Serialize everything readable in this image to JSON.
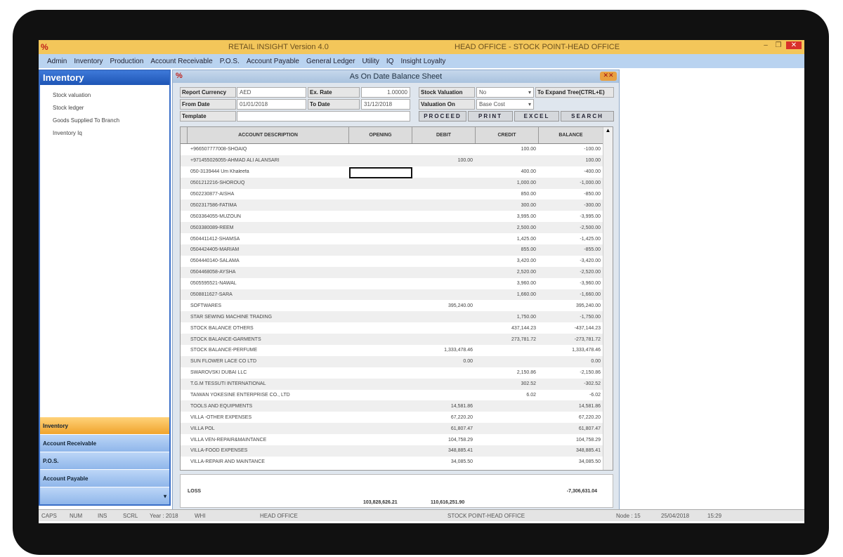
{
  "app": {
    "logo": "%",
    "title": "RETAIL INSIGHT  Version 4.0",
    "location": "HEAD OFFICE - STOCK POINT-HEAD OFFICE",
    "min": "–",
    "restore": "❐",
    "close": "✕"
  },
  "menu": [
    "Admin",
    "Inventory",
    "Production",
    "Account Receivable",
    "P.O.S.",
    "Account Payable",
    "General Ledger",
    "Utility",
    "IQ",
    "Insight Loyalty"
  ],
  "sidebar": {
    "title": "Inventory",
    "items": [
      "Stock valuation",
      "Stock ledger",
      "Goods Supplied To Branch",
      "Inventory Iq"
    ],
    "nav": [
      "Inventory",
      "Account Receivable",
      "P.O.S.",
      "Account Payable"
    ],
    "more": "▾"
  },
  "window": {
    "title": "As On Date Balance Sheet",
    "close": "✕✕"
  },
  "form": {
    "report_currency_label": "Report Currency",
    "report_currency": "AED",
    "ex_rate_label": "Ex. Rate",
    "ex_rate": "1.00000",
    "from_date_label": "From Date",
    "from_date": "01/01/2018",
    "to_date_label": "To Date",
    "to_date": "31/12/2018",
    "template_label": "Template",
    "template": "",
    "stock_valuation_label": "Stock Valuation",
    "stock_valuation": "No",
    "valuation_on_label": "Valuation On",
    "valuation_on": "Base Cost",
    "expand_hint": "To Expand Tree(CTRL+E)",
    "proceed": "PROCEED",
    "print": "PRINT",
    "excel": "EXCEL",
    "search": "SEARCH"
  },
  "grid": {
    "columns": [
      "ACCOUNT DESCRIPTION",
      "OPENING",
      "DEBIT",
      "CREDIT",
      "BALANCE"
    ],
    "rows": [
      [
        "+966507777008-SHOAIQ",
        "",
        "",
        "100.00",
        "-100.00"
      ],
      [
        "+971455026055-AHMAD ALI ALANSARI",
        "",
        "100.00",
        "",
        "100.00"
      ],
      [
        "050-3139444 Um Khaleefa",
        "",
        "",
        "400.00",
        "-400.00"
      ],
      [
        "0501212216-SHOROUQ",
        "",
        "",
        "1,000.00",
        "-1,000.00"
      ],
      [
        "0502230877-AISHA",
        "",
        "",
        "850.00",
        "-850.00"
      ],
      [
        "0502317586-FATIMA",
        "",
        "",
        "300.00",
        "-300.00"
      ],
      [
        "0503364055-MUZOUN",
        "",
        "",
        "3,995.00",
        "-3,995.00"
      ],
      [
        "0503380089-REEM",
        "",
        "",
        "2,500.00",
        "-2,500.00"
      ],
      [
        "0504411412-SHAMSA",
        "",
        "",
        "1,425.00",
        "-1,425.00"
      ],
      [
        "0504424405-MARIAM",
        "",
        "",
        "855.00",
        "-855.00"
      ],
      [
        "0504440140-SALAMA",
        "",
        "",
        "3,420.00",
        "-3,420.00"
      ],
      [
        "0504468058-AYSHA",
        "",
        "",
        "2,520.00",
        "-2,520.00"
      ],
      [
        "0505595521-NAWAL",
        "",
        "",
        "3,960.00",
        "-3,960.00"
      ],
      [
        "0508811627-SARA",
        "",
        "",
        "1,660.00",
        "-1,660.00"
      ],
      [
        "SOFTWARES",
        "",
        "395,240.00",
        "",
        "395,240.00"
      ],
      [
        "STAR SEWING MACHINE TRADING",
        "",
        "",
        "1,750.00",
        "-1,750.00"
      ],
      [
        "STOCK BALANCE OTHERS",
        "",
        "",
        "437,144.23",
        "-437,144.23"
      ],
      [
        "STOCK BALANCE-GARMENTS",
        "",
        "",
        "273,781.72",
        "-273,781.72"
      ],
      [
        "STOCK BALANCE-PERFUME",
        "",
        "1,333,478.46",
        "",
        "1,333,478.46"
      ],
      [
        "SUN FLOWER LACE CO LTD",
        "",
        "0.00",
        "",
        "0.00"
      ],
      [
        "SWAROVSKI DUBAI LLC",
        "",
        "",
        "2,150.86",
        "-2,150.86"
      ],
      [
        "T.G.M TESSUTI  INTERNATIONAL",
        "",
        "",
        "302.52",
        "-302.52"
      ],
      [
        "TAIWAN YOKESINE ENTERPRISE CO., LTD",
        "",
        "",
        "6.02",
        "-6.02"
      ],
      [
        "TOOLS AND EQUIPMENTS",
        "",
        "14,581.86",
        "",
        "14,581.86"
      ],
      [
        "VILLA -OTHER EXPENSES",
        "",
        "67,220.20",
        "",
        "67,220.20"
      ],
      [
        "VILLA POL",
        "",
        "61,807.47",
        "",
        "61,807.47"
      ],
      [
        "VILLA VEN-REPAIR&MAINTANCE",
        "",
        "104,758.29",
        "",
        "104,758.29"
      ],
      [
        "VILLA-FOOD EXPENSES",
        "",
        "348,885.41",
        "",
        "348,885.41"
      ],
      [
        "VILLA-REPAIR AND MAINTANCE",
        "",
        "34,085.50",
        "",
        "34,085.50"
      ]
    ]
  },
  "summary": {
    "loss_label": "LOSS",
    "loss": "-7,306,631.04",
    "total_opening": "103,828,626.21",
    "total_debit": "110,616,251.90"
  },
  "status": {
    "caps": "CAPS",
    "num": "NUM",
    "ins": "INS",
    "scrl": "SCRL",
    "year": "Year : 2018",
    "user": "WHI",
    "office": "HEAD OFFICE",
    "stock_point": "STOCK POINT-HEAD OFFICE",
    "node": "Node : 15",
    "date": "25/04/2018",
    "time": "15:29"
  }
}
